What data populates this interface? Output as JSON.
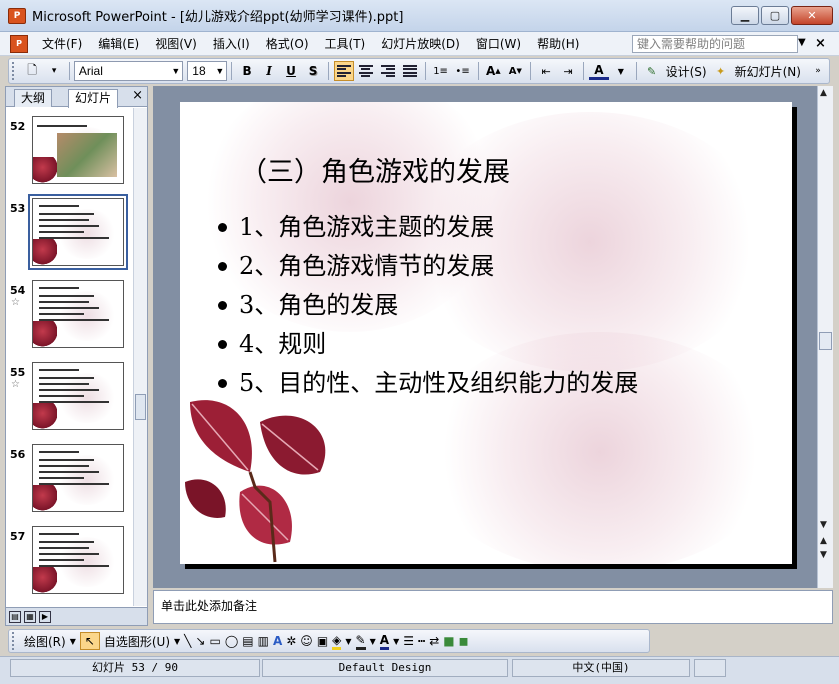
{
  "window": {
    "app_icon": "P",
    "title": "Microsoft PowerPoint - [幼儿游戏介绍ppt(幼师学习课件).ppt]"
  },
  "menu": {
    "items": [
      "文件(F)",
      "编辑(E)",
      "视图(V)",
      "插入(I)",
      "格式(O)",
      "工具(T)",
      "幻灯片放映(D)",
      "窗口(W)",
      "帮助(H)"
    ],
    "help_placeholder": "键入需要帮助的问题"
  },
  "toolbar": {
    "font_name": "Arial",
    "font_size": "18",
    "bold": "B",
    "italic": "I",
    "underline": "U",
    "shadow": "S",
    "design_label": "设计(S)",
    "new_slide_label": "新幻灯片(N)"
  },
  "left_panel": {
    "tab_outline": "大纲",
    "tab_slides": "幻灯片",
    "close": "×",
    "thumbnails": [
      {
        "num": "52",
        "star": false,
        "photo": true
      },
      {
        "num": "53",
        "star": false,
        "selected": true
      },
      {
        "num": "54",
        "star": true
      },
      {
        "num": "55",
        "star": true
      },
      {
        "num": "56",
        "star": false
      },
      {
        "num": "57",
        "star": false
      }
    ]
  },
  "slide": {
    "title": "（三）角色游戏的发展",
    "bullets": [
      "1、角色游戏主题的发展",
      "2、角色游戏情节的发展",
      "3、角色的发展",
      "4、规则",
      "5、目的性、主动性及组织能力的发展"
    ]
  },
  "notes": {
    "placeholder": "单击此处添加备注"
  },
  "drawing": {
    "draw_label": "绘图(R)",
    "autoshapes_label": "自选图形(U)"
  },
  "status": {
    "slide_info": "幻灯片 53 / 90",
    "design": "Default Design",
    "language": "中文(中国)"
  },
  "colors": {
    "leaf_red": "#8b1a30",
    "selection_blue": "#3a5f9f"
  }
}
